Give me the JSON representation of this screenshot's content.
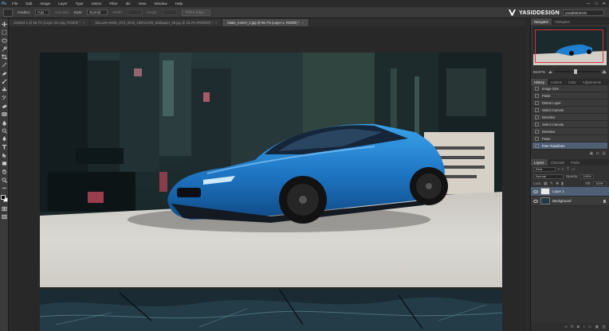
{
  "menubar": {
    "app_logo": "Ps",
    "items": [
      "File",
      "Edit",
      "Image",
      "Layer",
      "Type",
      "Select",
      "Filter",
      "3D",
      "View",
      "Window",
      "Help"
    ],
    "window_controls": [
      "—",
      "□",
      "✕"
    ]
  },
  "options": {
    "feather_label": "Feather:",
    "feather_value": "0 px",
    "antialias_label": "Anti-alias",
    "style_label": "Style:",
    "style_value": "Normal",
    "width_label": "Width:",
    "height_label": "Height:",
    "refine_label": "Refine Edge..."
  },
  "brand": {
    "text": "YASIDDESIGN"
  },
  "workspace": {
    "value": "yasidDESIGN"
  },
  "doc_tabs": [
    "Untitled-1 @ 66.7% (Layer 23 copy, RGB/8) *",
    "McLaren-650S_GT3_2015_1600x1200_Wallpaper_06.jpg @ 33.3% (RGB/8#) *",
    "blade_runner_2.jpg @ 66.7% (Layer 1, RGB/8) *"
  ],
  "panels": {
    "navigator_tabs": [
      "Navigator",
      "Histogram"
    ],
    "zoom_value": "66.67%",
    "zoom_level_fraction": 0.42,
    "history_tabs": [
      "History",
      "Actions",
      "Color",
      "Adjustments"
    ],
    "history_items": [
      "Image Size",
      "Paste",
      "Delete Layer",
      "Select Canvas",
      "Deselect",
      "Select Canvas",
      "Deselect",
      "Paste",
      "Free Transform"
    ],
    "history_active": 8,
    "layers_tabs": [
      "Layers",
      "Channels",
      "Paths"
    ],
    "kind_label": "Kind",
    "blend_mode": "Normal",
    "opacity_label": "Opacity:",
    "opacity_value": "100%",
    "lock_label": "Lock:",
    "fill_label": "Fill:",
    "fill_value": "100%",
    "layers": [
      {
        "name": "Layer 1",
        "active": true
      },
      {
        "name": "Background",
        "active": false
      }
    ]
  },
  "colors": {
    "accent": "#4f5f76",
    "car_blue": "#1f7fd0"
  }
}
